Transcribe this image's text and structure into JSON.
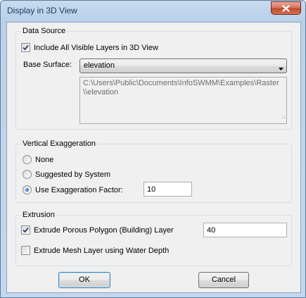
{
  "window": {
    "title": "Display in 3D View",
    "close_icon": "close-icon"
  },
  "data_source": {
    "label": "Data Source",
    "include_all_visible": {
      "label": "Include All Visible Layers in 3D View",
      "checked": true
    },
    "base_surface_label": "Base Surface:",
    "base_surface_value": "elevation",
    "path_text": "C:\\Users\\Public\\Documents\\InfoSWMM\\Examples\\Raster\\\\elevation"
  },
  "vertical_exaggeration": {
    "label": "Vertical Exaggeration",
    "options": [
      {
        "label": "None",
        "selected": false
      },
      {
        "label": "Suggested by System",
        "selected": false
      },
      {
        "label": "Use Exaggeration Factor:",
        "selected": true
      }
    ],
    "factor_value": "10"
  },
  "extrusion": {
    "label": "Extrusion",
    "porous_polygon": {
      "label": "Extrude Porous Polygon (Building) Layer",
      "checked": true,
      "value": "40"
    },
    "mesh_layer": {
      "label": "Extrude Mesh Layer using Water Depth",
      "checked": false
    }
  },
  "buttons": {
    "ok": "OK",
    "cancel": "Cancel"
  },
  "colors": {
    "frame": "#b9d1ea",
    "close_button": "#c7503a",
    "dialog_face": "#f0f0f0",
    "radio_selected": "#1b5fb5"
  }
}
